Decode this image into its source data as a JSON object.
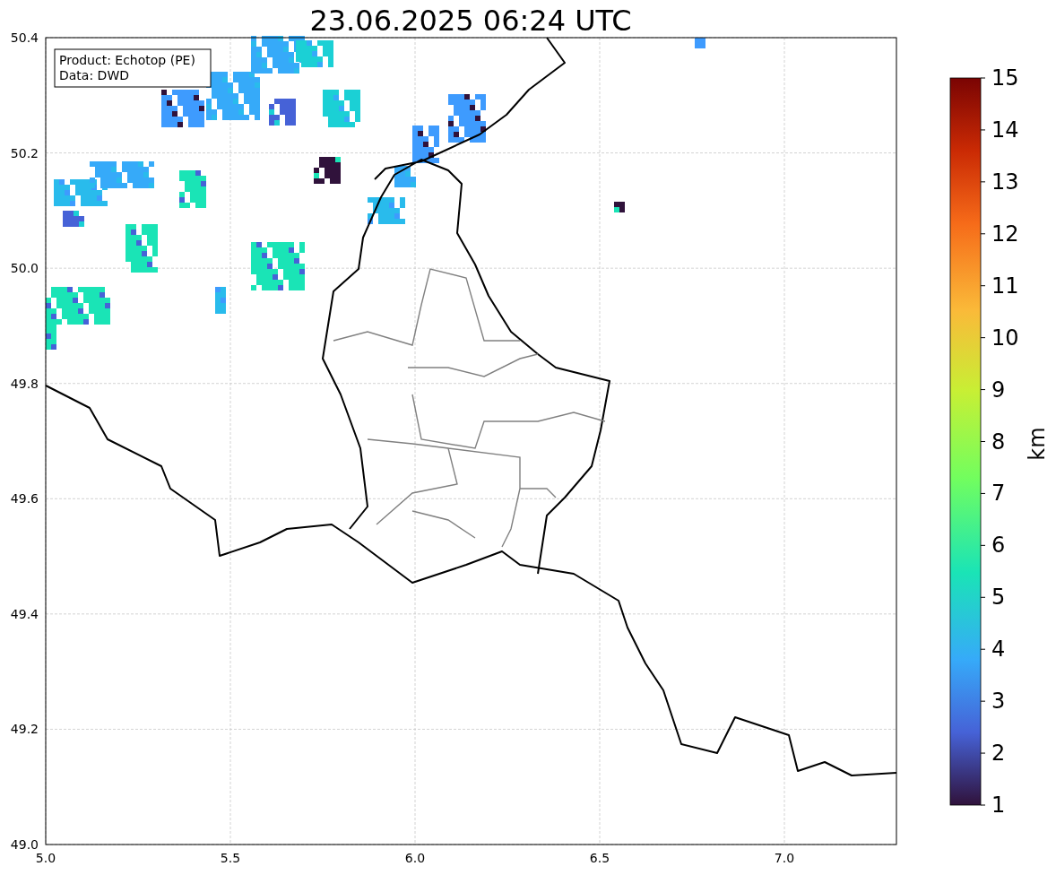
{
  "title": "23.06.2025 06:24 UTC",
  "info_box": [
    "Product: Echotop (PE)",
    "Data: DWD"
  ],
  "x_ticks": [
    "5.0",
    "5.5",
    "6.0",
    "6.5",
    "7.0"
  ],
  "y_ticks": [
    "50.4",
    "50.2",
    "50.0",
    "49.8",
    "49.6",
    "49.4",
    "49.2",
    "49.0"
  ],
  "colorbar": {
    "label": "km",
    "ticks": [
      "15",
      "14",
      "13",
      "12",
      "11",
      "10",
      "9",
      "8",
      "7",
      "6",
      "5",
      "4",
      "3",
      "2",
      "1"
    ]
  }
}
